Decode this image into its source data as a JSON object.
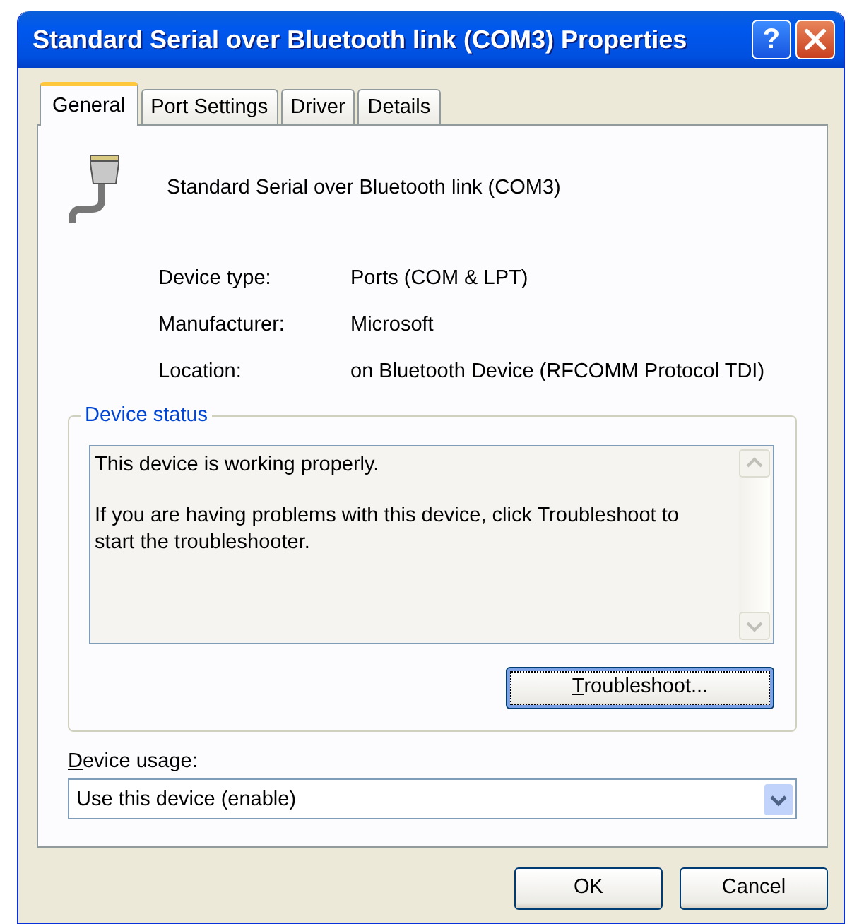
{
  "window": {
    "title": "Standard Serial over Bluetooth link (COM3) Properties",
    "help": "?"
  },
  "tabs": [
    {
      "label": "General",
      "selected": true
    },
    {
      "label": "Port Settings",
      "selected": false
    },
    {
      "label": "Driver",
      "selected": false
    },
    {
      "label": "Details",
      "selected": false
    }
  ],
  "device": {
    "name": "Standard Serial over Bluetooth link (COM3)"
  },
  "properties": [
    {
      "label": "Device type:",
      "value": "Ports (COM & LPT)"
    },
    {
      "label": "Manufacturer:",
      "value": "Microsoft"
    },
    {
      "label": "Location:",
      "value": "on Bluetooth Device (RFCOMM Protocol TDI)"
    }
  ],
  "device_status": {
    "title": "Device status",
    "paragraphs": [
      "This device is working properly.",
      "If you are having problems with this device, click Troubleshoot to start the troubleshooter."
    ],
    "button": {
      "label": "Troubleshoot...",
      "access_key_underlined": true
    }
  },
  "device_usage": {
    "label": "Device usage:",
    "access_key_underlined": true,
    "value": "Use this device (enable)"
  },
  "buttons": [
    "OK",
    "Cancel"
  ]
}
